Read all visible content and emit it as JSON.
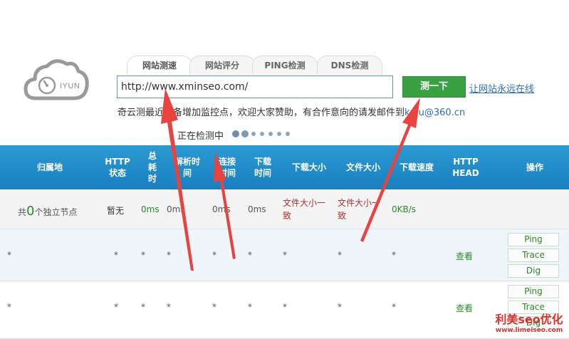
{
  "logo": {
    "text": "IYUN"
  },
  "tabs": [
    {
      "label": "网站测速",
      "active": true
    },
    {
      "label": "网站评分",
      "active": false
    },
    {
      "label": "PING检测",
      "active": false
    },
    {
      "label": "DNS检测",
      "active": false
    }
  ],
  "search": {
    "value": "http://www.xminseo.com/",
    "button_label": "测一下",
    "online_link": "让网站永远在线"
  },
  "notice": {
    "text": "奇云测最近准备增加监控点，欢迎大家赞助，有合作意向的请发邮件到",
    "email": "kefu@360.cn"
  },
  "status": {
    "text": "正在检测中"
  },
  "table": {
    "headers": [
      "归属地",
      "HTTP\n状态",
      "总\n耗\n时",
      "解析时\n间",
      "连接\n时间",
      "下载\n时间",
      "下载大小",
      "文件大小",
      "下载速度",
      "HTTP\nHEAD",
      "操作"
    ],
    "summary": {
      "prefix": "共",
      "count": "0",
      "suffix": "个独立节点",
      "http_status": "暂无",
      "total_time": "0ms",
      "resolve_time": "0ms",
      "connect_time": "0ms",
      "download_time": "0ms",
      "download_size": "文件大小一致",
      "file_size": "文件大小一致",
      "speed": "0KB/s"
    },
    "rows": [
      {
        "location": "*",
        "status": "*",
        "total": "*",
        "resolve": "*",
        "connect": "*",
        "download": "*",
        "dl_size": "*",
        "file_size": "*",
        "speed": "*",
        "view": "查看",
        "ops": [
          "Ping",
          "Trace",
          "Dig"
        ]
      },
      {
        "location": "*",
        "status": "*",
        "total": "*",
        "resolve": "*",
        "connect": "*",
        "download": "*",
        "dl_size": "*",
        "file_size": "*",
        "speed": "*",
        "view": "查看",
        "ops": [
          "Ping",
          "Trace",
          "Dig"
        ]
      }
    ]
  },
  "watermark": {
    "title": "利美seo优化",
    "url": "www.limeiseo.com"
  },
  "colors": {
    "header": "#1e8bc9",
    "button": "#3aa143",
    "arrow": "#e8433e",
    "link": "#2a6fb8"
  }
}
